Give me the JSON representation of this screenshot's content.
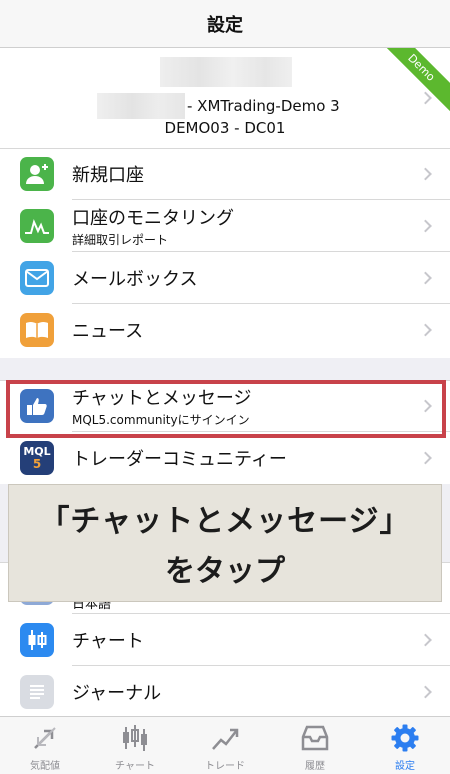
{
  "navbar": {
    "title": "設定"
  },
  "account": {
    "server": "- XMTrading-Demo 3",
    "login": "DEMO03 - DC01",
    "ribbon": "Demo"
  },
  "group1": [
    {
      "label": "新規口座",
      "icon": "add-user-icon"
    },
    {
      "label": "口座のモニタリング",
      "sub": "詳細取引レポート",
      "icon": "monitoring-icon"
    },
    {
      "label": "メールボックス",
      "icon": "mail-icon"
    },
    {
      "label": "ニュース",
      "icon": "book-icon"
    }
  ],
  "group2": [
    {
      "label": "チャットとメッセージ",
      "sub": "MQL5.communityにサインイン",
      "icon": "thumbs-up-icon"
    },
    {
      "label": "トレーダーコミュニティー",
      "icon": "mql5-icon",
      "icon_text": "MQL"
    }
  ],
  "group3": [
    {
      "label": "日本語",
      "icon": "language-icon"
    },
    {
      "label": "チャート",
      "icon": "candlestick-icon"
    },
    {
      "label": "ジャーナル",
      "icon": "journal-icon"
    }
  ],
  "overlay": {
    "line1": "「チャットとメッセージ」",
    "line2": "をタップ"
  },
  "tabs": [
    {
      "label": "気配値",
      "icon": "quotes-icon"
    },
    {
      "label": "チャート",
      "icon": "chart-icon"
    },
    {
      "label": "トレード",
      "icon": "trade-icon"
    },
    {
      "label": "履歴",
      "icon": "history-icon"
    },
    {
      "label": "設定",
      "icon": "settings-icon",
      "active": true
    }
  ],
  "colors": {
    "highlight_border": "#c8424a",
    "active_tab": "#2c7ef0",
    "demo_ribbon": "#5cb82e"
  }
}
